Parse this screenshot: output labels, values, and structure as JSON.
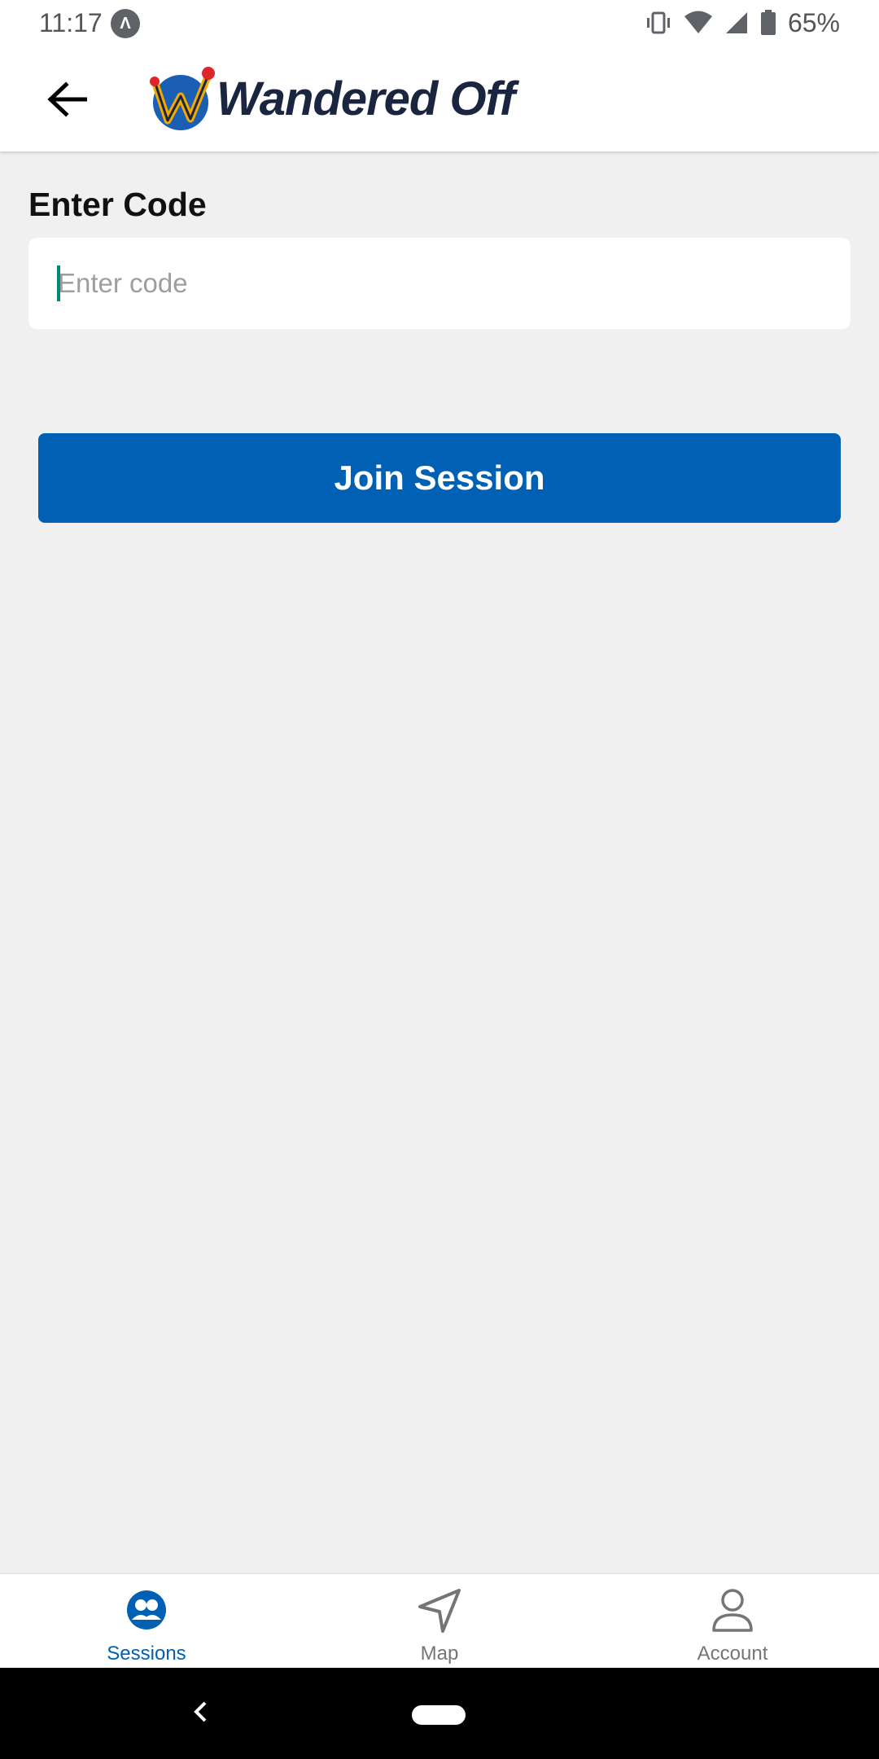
{
  "status_bar": {
    "time": "11:17",
    "app_icon": "Λ",
    "battery_percent": "65%",
    "icons": [
      "vibrate-icon",
      "wifi-icon",
      "signal-icon",
      "battery-icon"
    ]
  },
  "app_bar": {
    "back_icon": "arrow-left-icon",
    "logo_text": "Wandered Off"
  },
  "form": {
    "label": "Enter Code",
    "input_value": "",
    "input_placeholder": "Enter code",
    "submit_label": "Join Session"
  },
  "bottom_nav": {
    "items": [
      {
        "label": "Sessions",
        "icon": "sessions-icon",
        "active": true
      },
      {
        "label": "Map",
        "icon": "navigation-arrow-icon",
        "active": false
      },
      {
        "label": "Account",
        "icon": "person-icon",
        "active": false
      }
    ]
  },
  "colors": {
    "primary": "#0061b4",
    "background": "#f0f0f0",
    "caret": "#00897b",
    "logo_text": "#1a2540",
    "logo_circle": "#1a5fb4",
    "logo_accent": "#e0242b"
  }
}
